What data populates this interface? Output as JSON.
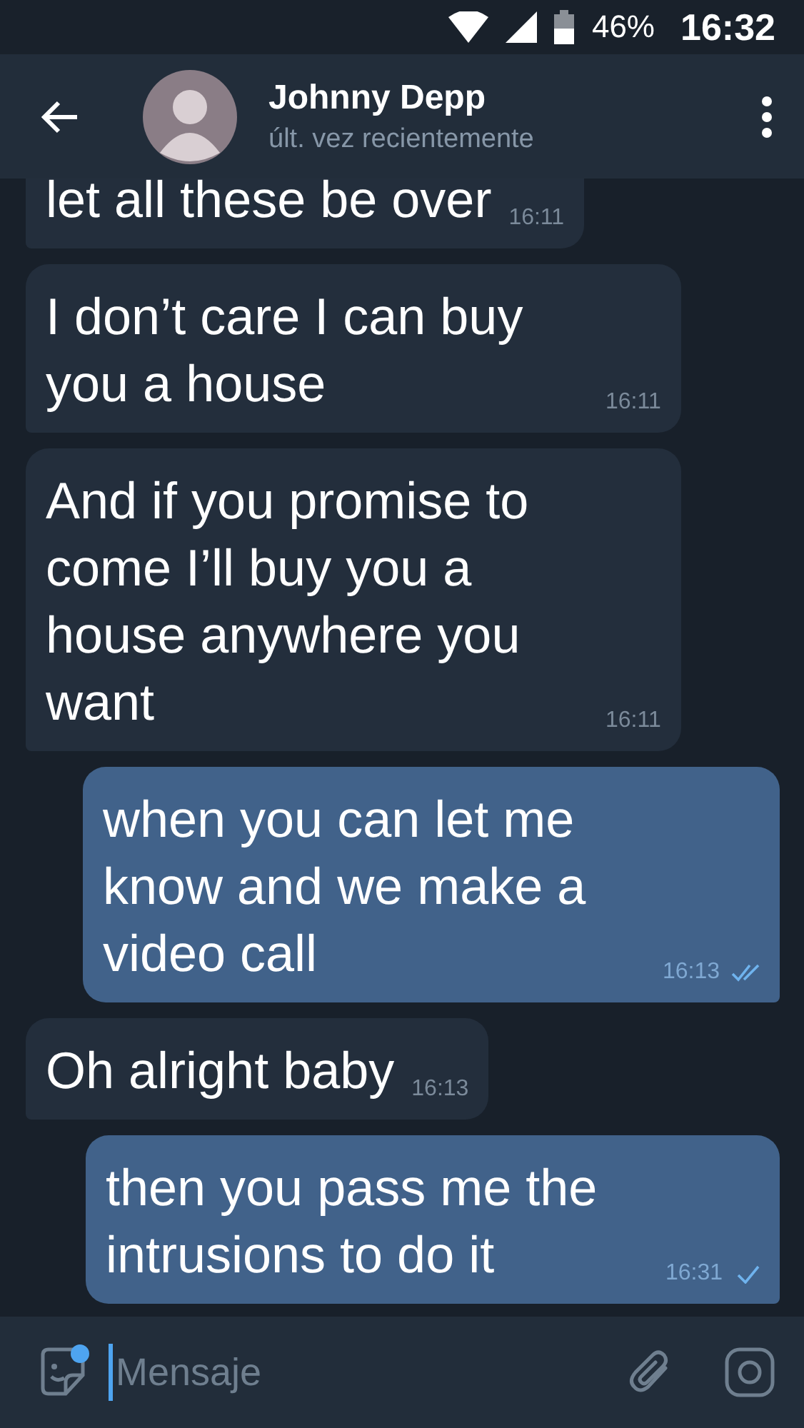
{
  "status_bar": {
    "battery": "46%",
    "time": "16:32"
  },
  "header": {
    "title": "Johnny Depp",
    "subtitle": "últ. vez recientemente"
  },
  "messages": [
    {
      "kind": "in",
      "text": "let all these be over",
      "time": "16:11"
    },
    {
      "kind": "in",
      "text": "I don’t care I can buy you a house",
      "time": "16:11"
    },
    {
      "kind": "in",
      "text": "And if you promise to come I’ll buy you a house anywhere you want",
      "time": "16:11"
    },
    {
      "kind": "out",
      "text": "when you can let me know and we make a video call",
      "time": "16:13",
      "read": true
    },
    {
      "kind": "in",
      "text": "Oh alright baby",
      "time": "16:13"
    },
    {
      "kind": "out",
      "text": "then you pass me the intrusions to do it",
      "time": "16:31",
      "read": false
    }
  ],
  "composer": {
    "placeholder": "Mensaje"
  }
}
